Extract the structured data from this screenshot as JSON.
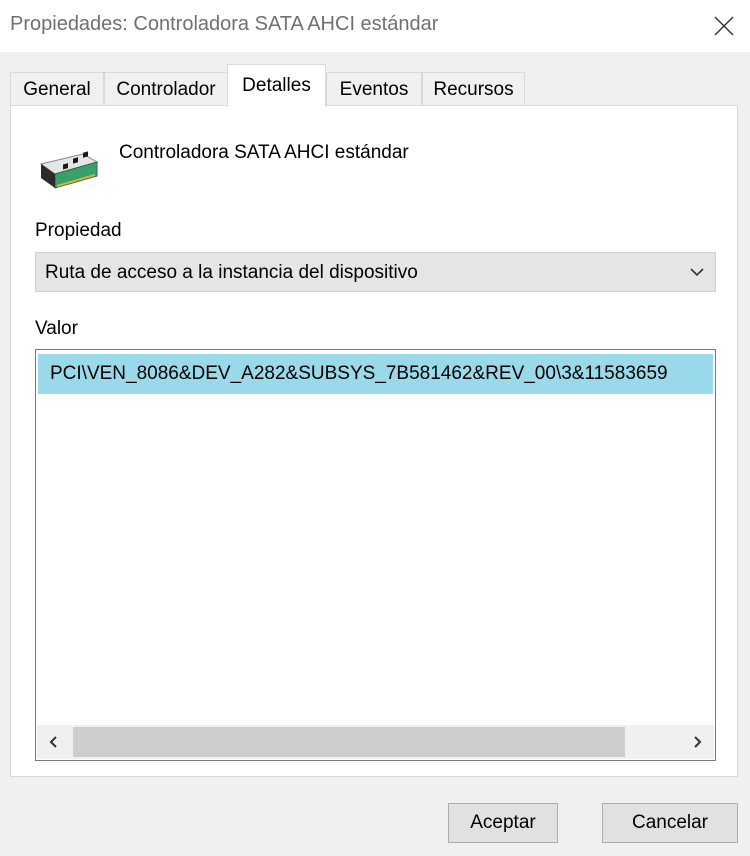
{
  "window": {
    "title": "Propiedades: Controladora SATA AHCI estándar"
  },
  "tabs": [
    {
      "label": "General"
    },
    {
      "label": "Controlador"
    },
    {
      "label": "Detalles"
    },
    {
      "label": "Eventos"
    },
    {
      "label": "Recursos"
    }
  ],
  "active_tab": "Detalles",
  "device": {
    "name": "Controladora SATA AHCI estándar",
    "icon": "controller-card-icon"
  },
  "property": {
    "label": "Propiedad",
    "selected": "Ruta de acceso a la instancia del dispositivo"
  },
  "value": {
    "label": "Valor",
    "items": [
      "PCI\\VEN_8086&DEV_A282&SUBSYS_7B581462&REV_00\\3&11583659"
    ]
  },
  "buttons": {
    "ok": "Aceptar",
    "cancel": "Cancelar"
  },
  "colors": {
    "selection": "#99d9ea",
    "window_bg": "#f0f0f0"
  }
}
